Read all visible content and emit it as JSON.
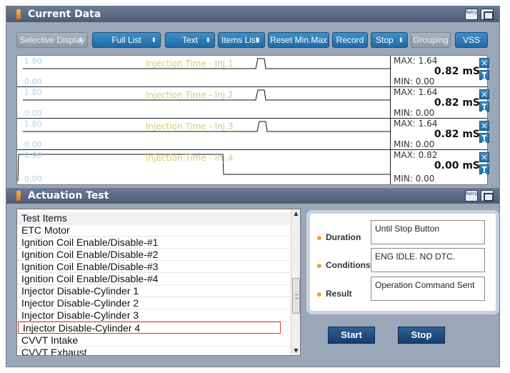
{
  "current_data": {
    "title": "Current Data",
    "retry_label": "Retry",
    "toolbar": [
      {
        "label": "Selective Display",
        "dropdown": true,
        "enabled": false
      },
      {
        "label": "Full List",
        "dropdown": true,
        "enabled": true
      },
      {
        "label": "Text",
        "dropdown": true,
        "enabled": true
      },
      {
        "label": "Items List",
        "dropdown": true,
        "enabled": true
      },
      {
        "label": "Reset Min.Max",
        "dropdown": false,
        "enabled": true
      },
      {
        "label": "Record",
        "dropdown": false,
        "enabled": true
      },
      {
        "label": "Stop",
        "dropdown": true,
        "enabled": true
      },
      {
        "label": "Grouping",
        "dropdown": false,
        "enabled": false
      },
      {
        "label": "VSS",
        "dropdown": false,
        "enabled": true
      }
    ],
    "graphs": [
      {
        "title": "Injection Time - Inj.1",
        "y_max": "1.80",
        "y_min": "0.00",
        "max": "MAX: 1.64",
        "min": "MIN: 0.00",
        "value": "0.82 mS"
      },
      {
        "title": "Injection Time - Inj.2",
        "y_max": "1.80",
        "y_min": "0.00",
        "max": "MAX: 1.64",
        "min": "MIN: 0.00",
        "value": "0.82 mS"
      },
      {
        "title": "Injection Time - Inj.3",
        "y_max": "1.80",
        "y_min": "0.00",
        "max": "MAX: 1.64",
        "min": "MIN: 0.00",
        "value": "0.82 mS"
      },
      {
        "title": "Injection Time - Inj.4",
        "y_max": "0.90",
        "y_min": "0.00",
        "max": "MAX: 0.82",
        "min": "MIN: 0.00",
        "value": "0.00 mS"
      }
    ]
  },
  "actuation_test": {
    "title": "Actuation Test",
    "retry_label": "Retry",
    "list_header": "Test Items",
    "items": [
      "ETC Motor",
      "Ignition Coil Enable/Disable-#1",
      "Ignition Coil Enable/Disable-#2",
      "Ignition Coil Enable/Disable-#3",
      "Ignition Coil Enable/Disable-#4",
      "Injector Disable-Cylinder 1",
      "Injector Disable-Cylinder 2",
      "Injector Disable-Cylinder 3",
      "Injector Disable-Cylinder 4",
      "CVVT Intake",
      "CVVT Exhaust"
    ],
    "selected_item": "Injector Disable-Cylinder 4",
    "duration_label": "Duration",
    "duration_value": "Until Stop Button",
    "conditions_label": "Conditions",
    "conditions_value": "ENG IDLE. NO DTC.",
    "result_label": "Result",
    "result_value": "Operation Command Sent",
    "start_label": "Start",
    "stop_label": "Stop"
  }
}
